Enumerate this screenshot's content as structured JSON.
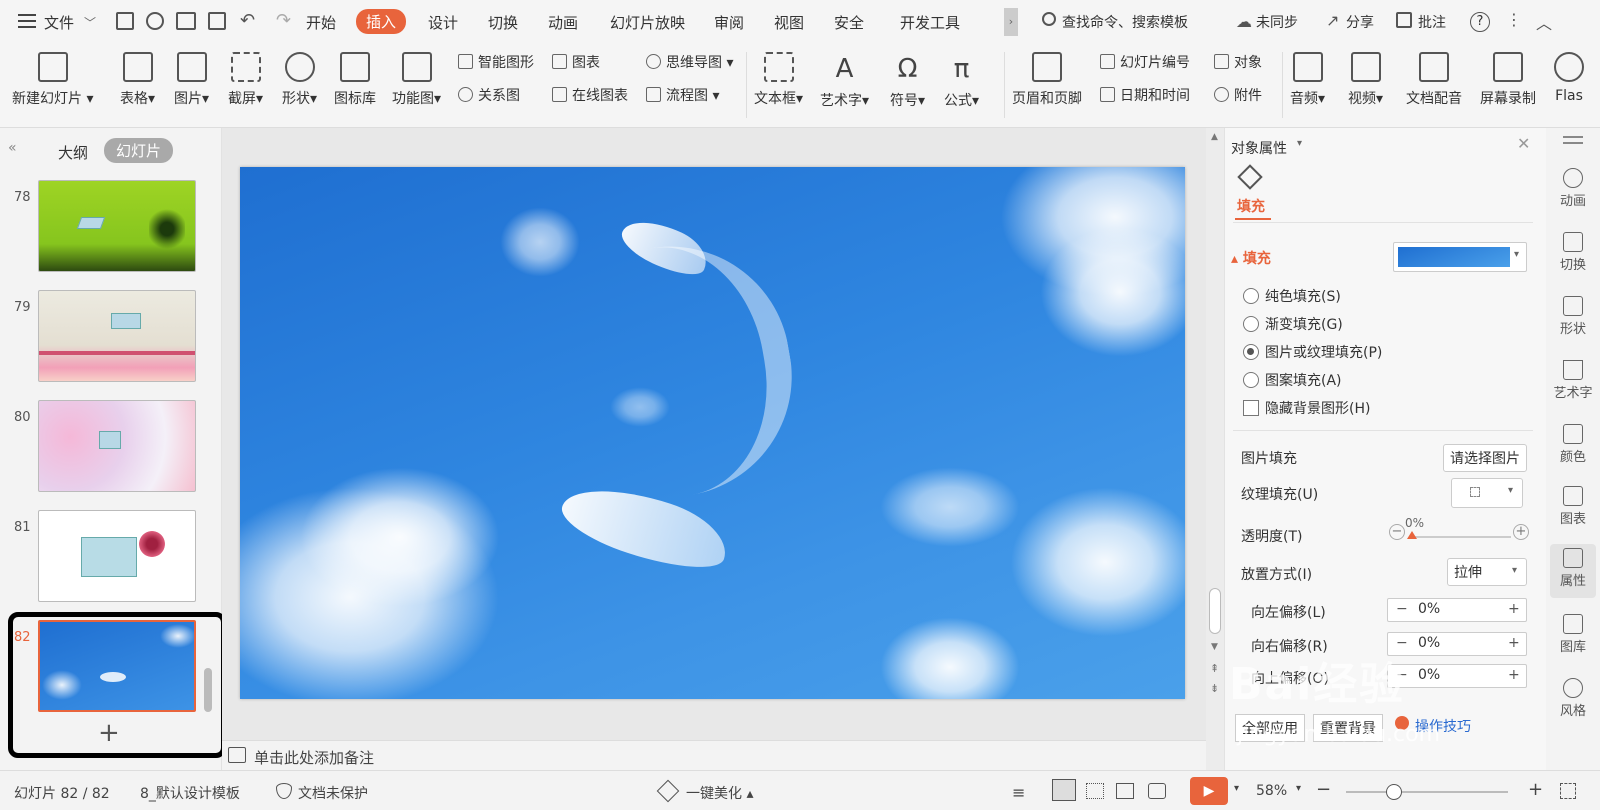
{
  "menubar": {
    "file": "文件",
    "tabs": [
      "开始",
      "插入",
      "设计",
      "切换",
      "动画",
      "幻灯片放映",
      "审阅",
      "视图",
      "安全",
      "开发工具"
    ],
    "active_tab": "插入",
    "search": "查找命令、搜索模板",
    "sync": "未同步",
    "share": "分享",
    "review": "批注"
  },
  "ribbon": {
    "new_slide": "新建幻灯片",
    "table": "表格",
    "picture": "图片",
    "screenshot": "截屏",
    "shape": "形状",
    "icon_lib": "图标库",
    "func_chart": "功能图",
    "smart_art": "智能图形",
    "chart": "图表",
    "mind_map": "思维导图",
    "relation": "关系图",
    "online_chart": "在线图表",
    "flowchart": "流程图",
    "textbox": "文本框",
    "art_text": "艺术字",
    "symbol": "符号",
    "formula": "公式",
    "header_footer": "页眉和页脚",
    "slide_number": "幻灯片编号",
    "object": "对象",
    "datetime": "日期和时间",
    "attachment": "附件",
    "audio": "音频",
    "video": "视频",
    "narration": "文档配音",
    "screen_rec": "屏幕录制",
    "flash": "Flas"
  },
  "leftpanel": {
    "tab_outline": "大纲",
    "tab_slides": "幻灯片",
    "slides": [
      {
        "num": "78"
      },
      {
        "num": "79"
      },
      {
        "num": "80"
      },
      {
        "num": "81"
      },
      {
        "num": "82"
      }
    ],
    "add": "+"
  },
  "notes": {
    "placeholder": "单击此处添加备注"
  },
  "rightpanel": {
    "title": "对象属性",
    "tab_fill": "填充",
    "section_fill": "填充",
    "options": [
      "纯色填充(S)",
      "渐变填充(G)",
      "图片或纹理填充(P)",
      "图案填充(A)"
    ],
    "selected_option": "图片或纹理填充(P)",
    "hide_bg": "隐藏背景图形(H)",
    "pic_fill_label": "图片填充",
    "pic_fill_value": "请选择图片",
    "texture_label": "纹理填充(U)",
    "transparency_label": "透明度(T)",
    "transparency_value": "0%",
    "placement_label": "放置方式(I)",
    "placement_value": "拉伸",
    "offset_left_label": "向左偏移(L)",
    "offset_left_value": "0%",
    "offset_right_label": "向右偏移(R)",
    "offset_right_value": "0%",
    "offset_up_label": "向上偏移(O)",
    "offset_up_value": "0%",
    "apply_all": "全部应用",
    "reset_bg": "重置背景",
    "tips": "操作技巧"
  },
  "sidebar": [
    "动画",
    "切换",
    "形状",
    "艺术字",
    "颜色",
    "图表",
    "属性",
    "图库",
    "风格"
  ],
  "statusbar": {
    "slide_pos": "幻灯片 82 / 82",
    "template": "8_默认设计模板",
    "protect": "文档未保护",
    "beautify": "一键美化",
    "zoom": "58%"
  },
  "watermark": {
    "brand": "Bai经验",
    "url": "jingyan.baidu.com"
  },
  "colors": {
    "accent": "#e8643c",
    "sky": "#2f86e0",
    "highlight": "#000000"
  }
}
